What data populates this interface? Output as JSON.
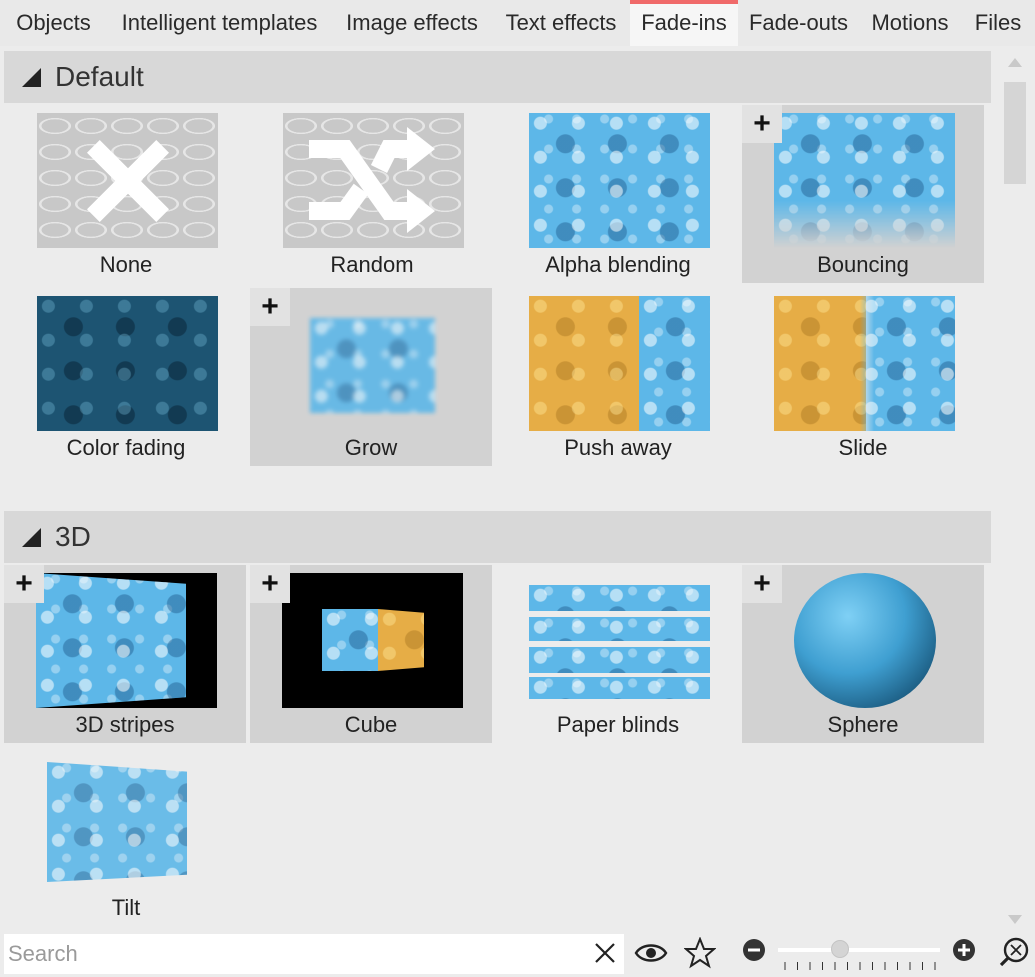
{
  "tabs": [
    {
      "label": "Objects",
      "active": false
    },
    {
      "label": "Intelligent templates",
      "active": false
    },
    {
      "label": "Image effects",
      "active": false
    },
    {
      "label": "Text effects",
      "active": false
    },
    {
      "label": "Fade-ins",
      "active": true
    },
    {
      "label": "Fade-outs",
      "active": false
    },
    {
      "label": "Motions",
      "active": false
    },
    {
      "label": "Files",
      "active": false
    }
  ],
  "sections": [
    {
      "title": "Default",
      "effects": [
        {
          "label": "None",
          "icon": "x-icon",
          "selected": false,
          "plus": false
        },
        {
          "label": "Random",
          "icon": "shuffle-icon",
          "selected": false,
          "plus": false
        },
        {
          "label": "Alpha blending",
          "selected": false,
          "plus": false
        },
        {
          "label": "Bouncing",
          "selected": true,
          "plus": true
        },
        {
          "label": "Color fading",
          "selected": false,
          "plus": false
        },
        {
          "label": "Grow",
          "selected": true,
          "plus": true
        },
        {
          "label": "Push away",
          "selected": false,
          "plus": false
        },
        {
          "label": "Slide",
          "selected": false,
          "plus": false
        }
      ]
    },
    {
      "title": "3D",
      "effects": [
        {
          "label": "3D stripes",
          "selected": true,
          "plus": true
        },
        {
          "label": "Cube",
          "selected": true,
          "plus": true
        },
        {
          "label": "Paper blinds",
          "selected": false,
          "plus": false
        },
        {
          "label": "Sphere",
          "selected": true,
          "plus": true
        },
        {
          "label": "Tilt",
          "selected": false,
          "plus": false
        }
      ]
    }
  ],
  "plus_symbol": "+",
  "search": {
    "placeholder": "Search",
    "value": ""
  },
  "zoom": {
    "level": 0.38
  },
  "colors": {
    "active_tab_accent": "#f06a6a",
    "selected_tile": "#d2d2d2",
    "section_header": "#d8d8d8"
  }
}
